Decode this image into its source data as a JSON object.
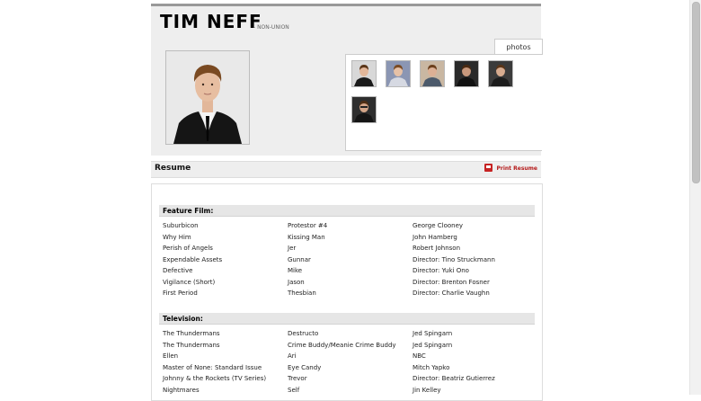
{
  "actor": {
    "name": "TIM NEFF",
    "union": "- NON-UNION"
  },
  "tabs": {
    "photos": "photos"
  },
  "resume": {
    "title": "Resume",
    "print_label": "Print Resume"
  },
  "sections": [
    {
      "heading": "Feature Film:",
      "rows": [
        [
          "Suburbicon",
          "Protestor #4",
          "George Clooney"
        ],
        [
          "Why Him",
          "Kissing Man",
          "John Hamberg"
        ],
        [
          "Perish of Angels",
          "Jer",
          "Robert Johnson"
        ],
        [
          "Expendable Assets",
          "Gunnar",
          "Director: Tino Struckmann"
        ],
        [
          "Defective",
          "Mike",
          "Director: Yuki Ono"
        ],
        [
          "Vigilance (Short)",
          "Jason",
          "Director: Brenton Fosner"
        ],
        [
          "First Period",
          "Thesbian",
          "Director: Charlie Vaughn"
        ]
      ]
    },
    {
      "heading": "Television:",
      "rows": [
        [
          "The Thundermans",
          "Destructo",
          "Jed Spingarn"
        ],
        [
          "The Thundermans",
          "Crime Buddy/Meanie Crime Buddy",
          "Jed Spingarn"
        ],
        [
          "Ellen",
          "Ari",
          "NBC"
        ],
        [
          "Master of None: Standard Issue",
          "Eye Candy",
          "Mitch Yapko"
        ],
        [
          "Johnny & the Rockets (TV Series)",
          "Trevor",
          "Director: Beatriz Gutierrez"
        ],
        [
          "Nightmares",
          "Self",
          "Jin Kelley"
        ]
      ]
    }
  ]
}
